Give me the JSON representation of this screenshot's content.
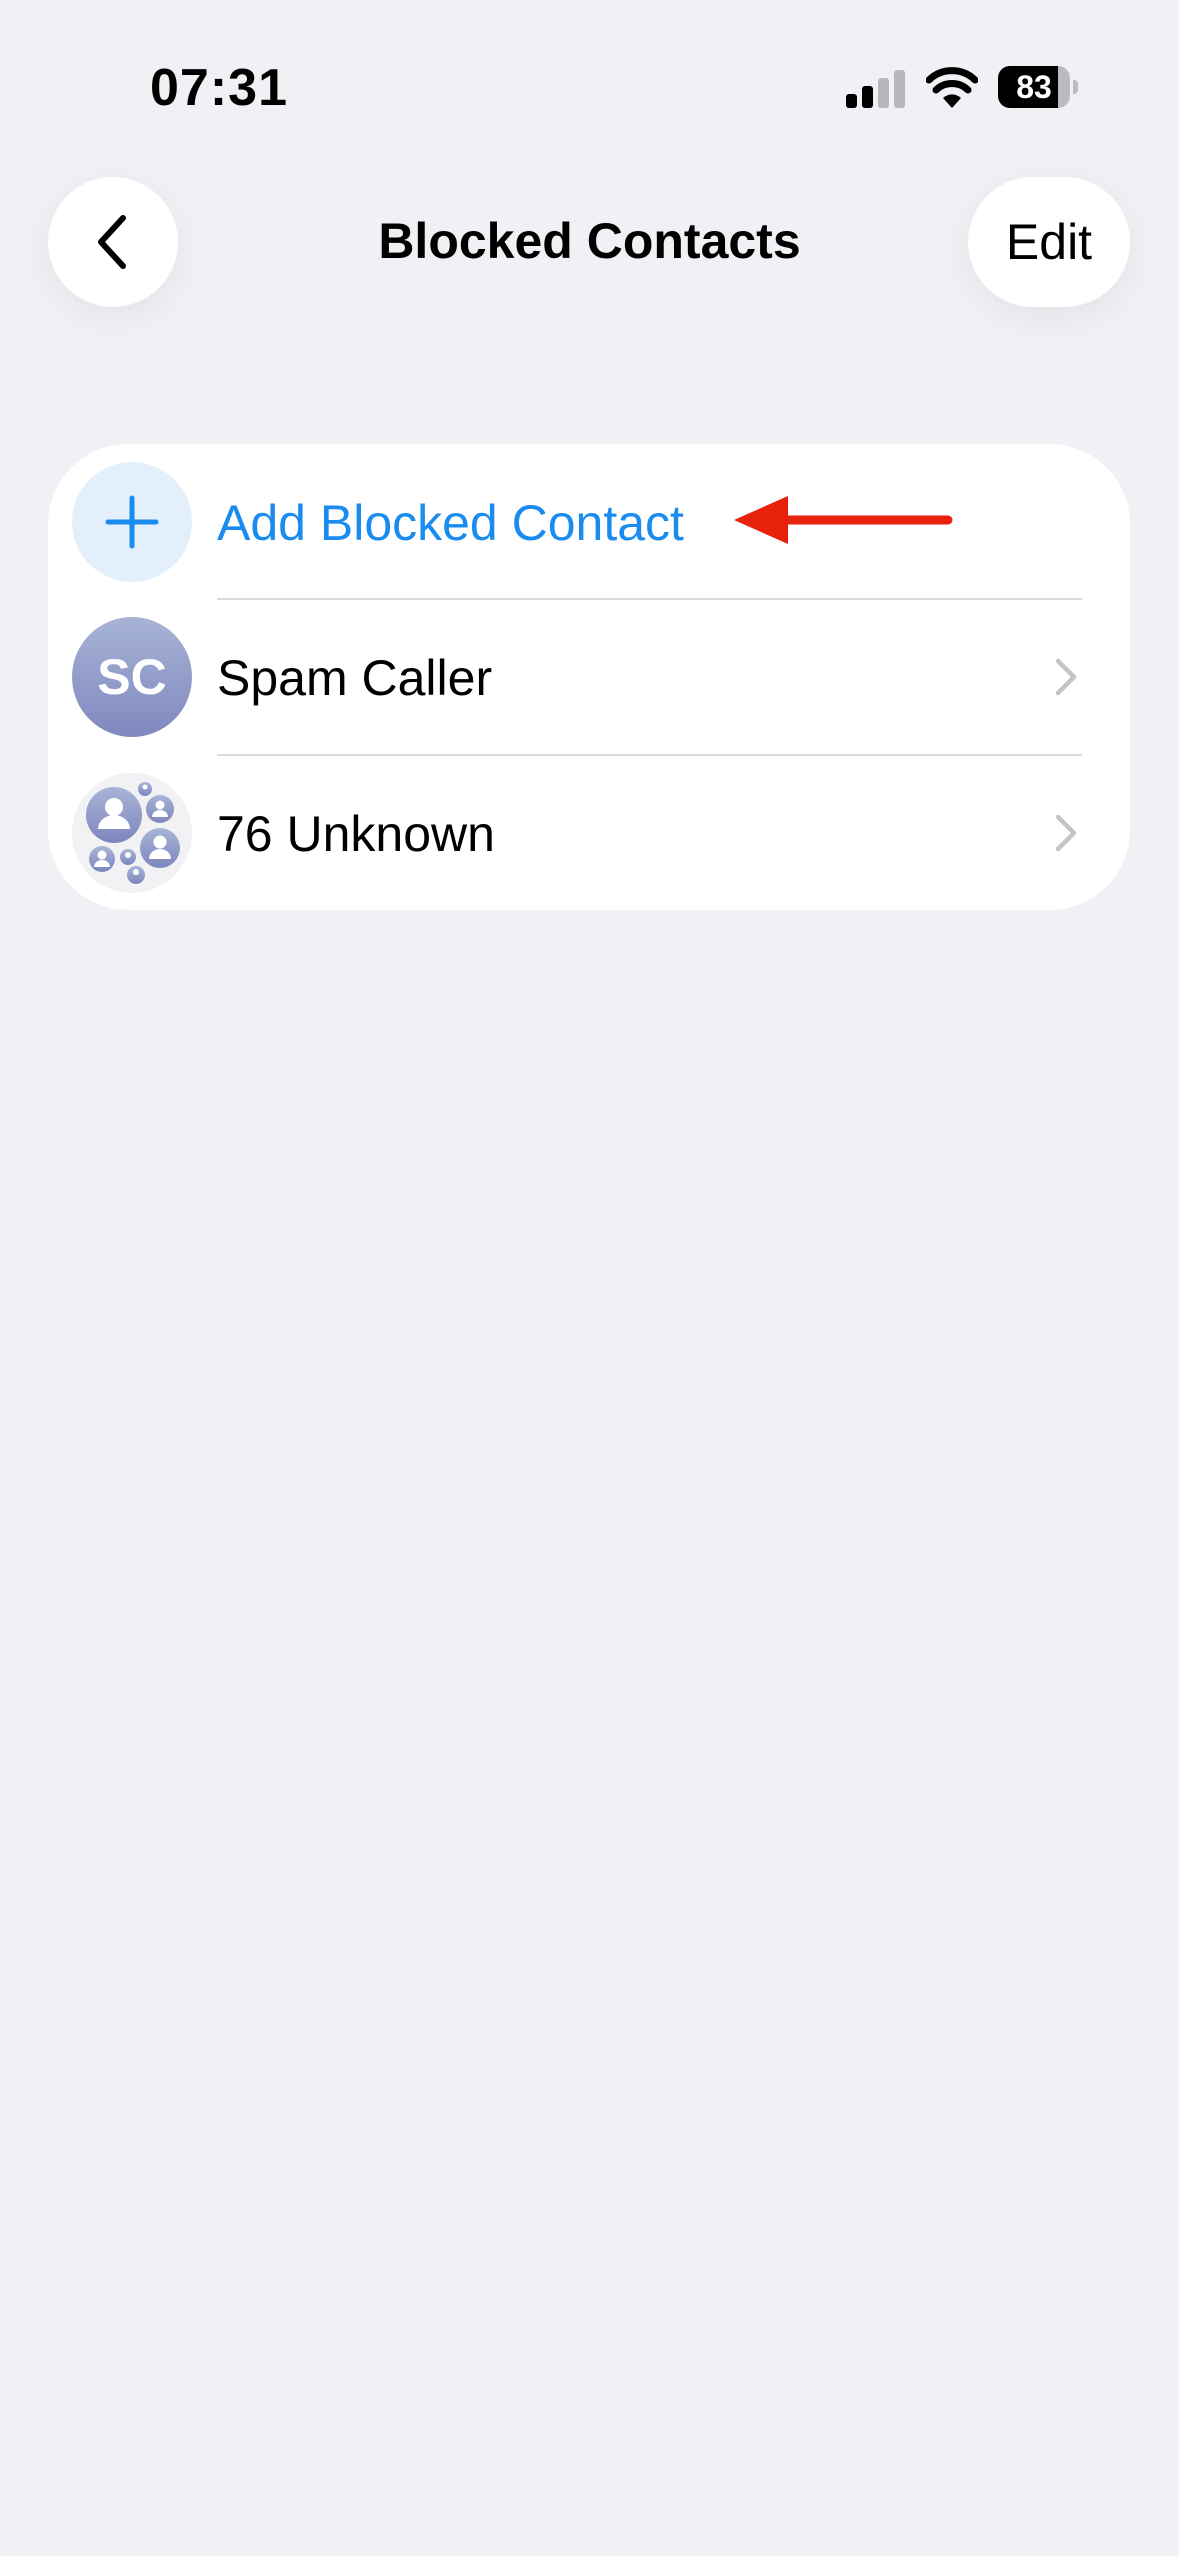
{
  "status_bar": {
    "time": "07:31",
    "battery_level": "83",
    "battery_fraction": 0.83,
    "icons": [
      "signal-icon",
      "wifi-icon",
      "battery-icon"
    ]
  },
  "nav": {
    "back_icon": "chevron-left-icon",
    "title": "Blocked Contacts",
    "edit_label": "Edit"
  },
  "list": {
    "add_item": {
      "label": "Add Blocked Contact",
      "icon": "plus-icon"
    },
    "contacts": [
      {
        "label": "Spam Caller",
        "avatar_initials": "SC"
      },
      {
        "label": "76 Unknown",
        "avatar_icon": "group-avatar-icon"
      }
    ]
  },
  "annotation": {
    "icon": "red-arrow-icon"
  },
  "colors": {
    "background": "#f0f0f5",
    "accent": "#1a8cf0",
    "annotation": "#e8210c"
  }
}
